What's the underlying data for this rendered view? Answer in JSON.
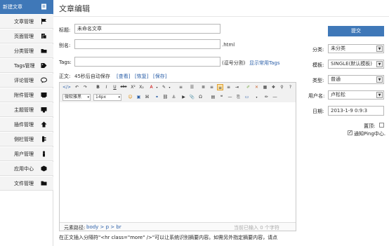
{
  "sidebar": {
    "items": [
      {
        "label": "新建文章",
        "icon": "document-icon"
      },
      {
        "label": "文章管理",
        "icon": "flag-icon"
      },
      {
        "label": "页面管理",
        "icon": "page-icon"
      },
      {
        "label": "分类管理",
        "icon": "folder-icon"
      },
      {
        "label": "Tags管理",
        "icon": "tag-icon"
      },
      {
        "label": "评论管理",
        "icon": "comment-icon"
      },
      {
        "label": "附件管理",
        "icon": "attachment-icon"
      },
      {
        "label": "主题管理",
        "icon": "theme-icon"
      },
      {
        "label": "插件管理",
        "icon": "plugin-icon"
      },
      {
        "label": "侧栏管理",
        "icon": "sidebar-icon"
      },
      {
        "label": "用户管理",
        "icon": "user-icon"
      },
      {
        "label": "应用中心",
        "icon": "app-icon"
      },
      {
        "label": "文件管理",
        "icon": "file-icon"
      }
    ]
  },
  "page": {
    "title": "文章编辑"
  },
  "form": {
    "title_label": "标题:",
    "title_value": "未命名文章",
    "alias_label": "别名:",
    "alias_suffix": ".html",
    "tags_label": "Tags:",
    "tags_hint": "(逗号分割)",
    "tags_show_common": "显示常用Tags",
    "body_label": "正文:",
    "autosave_text": "45秒后自动保存",
    "autosave_view": "[查看]",
    "autosave_restore": "[恢复]",
    "autosave_save": "[保存]"
  },
  "editor": {
    "font_family": "微软雅黑",
    "font_size": "14px",
    "status_path_label": "元素路径:",
    "status_path": "body > p > br",
    "status_count": "当前已输入 0 个字符"
  },
  "bottom_note": "在正文插入分隔符\"<hr class=\"more\" />\"可以让系统识别摘要内容。如需另外指定摘要内容，请点",
  "right": {
    "publish_label": "提交",
    "category_label": "分类:",
    "category_value": "未分类",
    "template_label": "模板:",
    "template_value": "SINGLE(默认模板)",
    "type_label": "类型:",
    "type_value": "普通",
    "user_label": "用户名:",
    "user_value": "卢松松",
    "date_label": "日期:",
    "date_value": "2013-1-9 0:9:3",
    "top_label": "置顶:",
    "ping_label": "通知Ping中心."
  },
  "colors": {
    "accent": "#3f78b8",
    "link": "#2b5fa8"
  }
}
